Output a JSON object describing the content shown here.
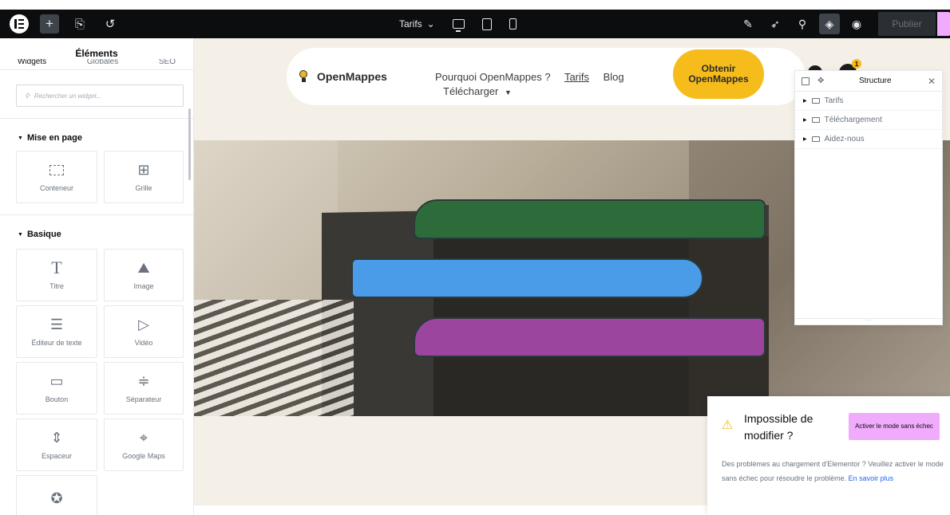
{
  "topbar": {
    "page_select": "Tarifs",
    "publish_label": "Publier"
  },
  "panel": {
    "title": "Éléments",
    "tabs": [
      "Widgets",
      "Globales",
      "SEO"
    ],
    "search_placeholder": "Rechercher un widget...",
    "sections": [
      {
        "title": "Mise en page",
        "widgets": [
          {
            "label": "Conteneur",
            "icon": "container-icon"
          },
          {
            "label": "Grille",
            "icon": "grid-icon"
          }
        ]
      },
      {
        "title": "Basique",
        "widgets": [
          {
            "label": "Titre",
            "icon": "heading-icon"
          },
          {
            "label": "Image",
            "icon": "image-icon"
          },
          {
            "label": "Éditeur de texte",
            "icon": "text-editor-icon"
          },
          {
            "label": "Vidéo",
            "icon": "video-icon"
          },
          {
            "label": "Bouton",
            "icon": "button-icon"
          },
          {
            "label": "Séparateur",
            "icon": "divider-icon"
          },
          {
            "label": "Espaceur",
            "icon": "spacer-icon"
          },
          {
            "label": "Google Maps",
            "icon": "map-icon"
          },
          {
            "label": "",
            "icon": "star-icon"
          }
        ]
      }
    ]
  },
  "site": {
    "brand": "OpenMappes",
    "nav": {
      "why": "Pourquoi OpenMappes ?",
      "pricing": "Tarifs",
      "blog": "Blog",
      "download": "Télécharger"
    },
    "cta": "Obtenir OpenMappes",
    "badge": "1"
  },
  "structure": {
    "title": "Structure",
    "items": [
      "Tarifs",
      "Téléchargement",
      "Aidez-nous"
    ]
  },
  "notice": {
    "title": "Impossible de modifier ?",
    "button": "Activer le mode sans échec",
    "text": "Des problèmes au chargement d'Elementor ? Veuillez activer le mode sans échec pour résoudre le problème.",
    "link": "En savoir plus"
  }
}
